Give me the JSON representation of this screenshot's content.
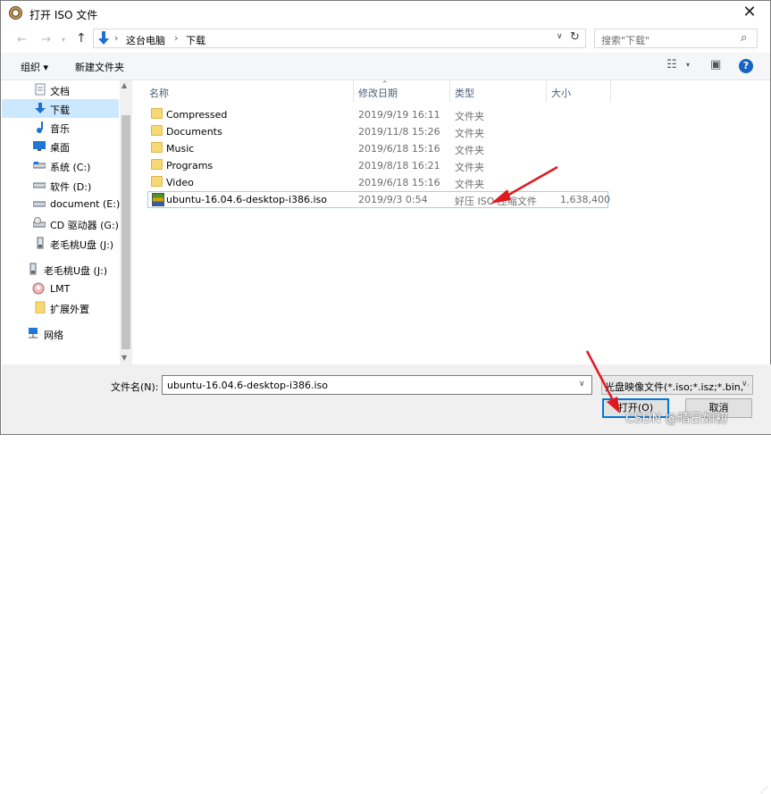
{
  "window": {
    "title": "打开 ISO 文件"
  },
  "nav": {
    "back": "←",
    "forward": "→",
    "up": "↑"
  },
  "address": {
    "crumbs": [
      "这台电脑",
      "下载"
    ],
    "separator": "›"
  },
  "search": {
    "placeholder": "搜索\"下载\""
  },
  "toolbar": {
    "organize": "组织 ▾",
    "new_folder": "新建文件夹"
  },
  "sidebar": {
    "items": [
      {
        "label": "文档",
        "icon": "document-icon"
      },
      {
        "label": "下载",
        "icon": "download-icon",
        "selected": true
      },
      {
        "label": "音乐",
        "icon": "music-icon"
      },
      {
        "label": "桌面",
        "icon": "desktop-icon"
      },
      {
        "label": "系统 (C:)",
        "icon": "drive-icon"
      },
      {
        "label": "软件 (D:)",
        "icon": "drive-icon"
      },
      {
        "label": "document (E:)",
        "icon": "drive-icon"
      },
      {
        "label": "CD 驱动器 (G:)",
        "icon": "cd-drive-icon"
      },
      {
        "label": "老毛桃U盘 (J:)",
        "icon": "usb-icon"
      },
      {
        "label": "老毛桃U盘 (J:)",
        "icon": "usb-icon"
      },
      {
        "label": "LMT",
        "icon": "user-icon"
      },
      {
        "label": "扩展外置",
        "icon": "folder-icon"
      },
      {
        "label": "网络",
        "icon": "network-icon"
      }
    ]
  },
  "columns": {
    "name": "名称",
    "modified": "修改日期",
    "type": "类型",
    "size": "大小"
  },
  "files": [
    {
      "name": "Compressed",
      "modified": "2019/9/19 16:11",
      "type": "文件夹",
      "size": "",
      "icon": "folder-icon"
    },
    {
      "name": "Documents",
      "modified": "2019/11/8 15:26",
      "type": "文件夹",
      "size": "",
      "icon": "folder-icon"
    },
    {
      "name": "Music",
      "modified": "2019/6/18 15:16",
      "type": "文件夹",
      "size": "",
      "icon": "folder-icon"
    },
    {
      "name": "Programs",
      "modified": "2019/8/18 16:21",
      "type": "文件夹",
      "size": "",
      "icon": "folder-icon"
    },
    {
      "name": "Video",
      "modified": "2019/6/18 15:16",
      "type": "文件夹",
      "size": "",
      "icon": "folder-icon"
    },
    {
      "name": "ubuntu-16.04.6-desktop-i386.iso",
      "modified": "2019/9/3 0:54",
      "type": "好压 ISO 压缩文件",
      "size": "1,638,400",
      "icon": "archive-icon"
    }
  ],
  "footer": {
    "filename_label": "文件名(N):",
    "filename_value": "ubuntu-16.04.6-desktop-i386.iso",
    "filter": "光盘映像文件(*.iso;*.isz;*.bin;*",
    "open": "打开(O)",
    "cancel": "取消"
  },
  "watermark": "CSDN @晴日如初",
  "colors": {
    "accent": "#0078d7",
    "selection": "#cce8ff",
    "annotation_arrow": "#e0191f"
  }
}
